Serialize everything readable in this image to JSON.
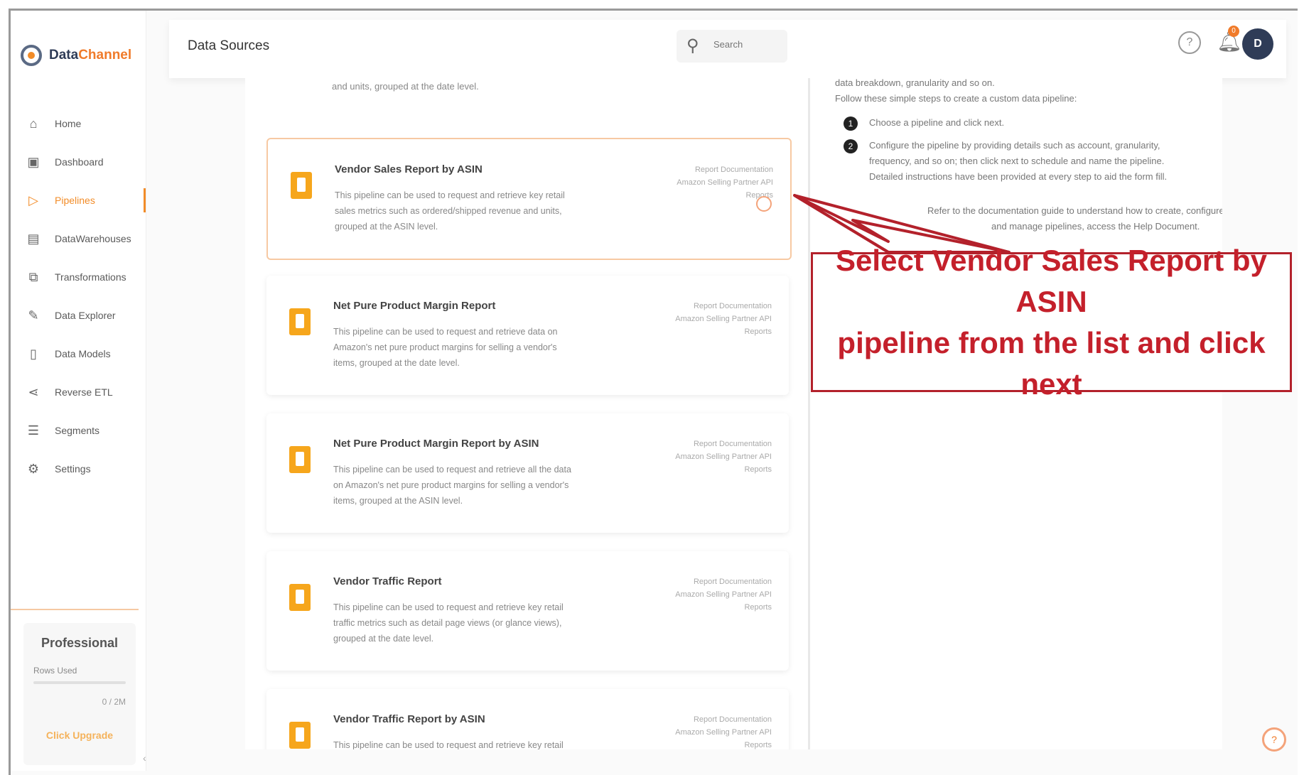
{
  "brand": {
    "name_main": "Data",
    "name_accent": "Channel"
  },
  "sidebar": {
    "items": [
      {
        "label": "Home",
        "icon": "home-icon",
        "glyph": "⌂"
      },
      {
        "label": "Dashboard",
        "icon": "dashboard-icon",
        "glyph": "▣"
      },
      {
        "label": "Pipelines",
        "icon": "pipelines-icon",
        "glyph": "▷"
      },
      {
        "label": "DataWarehouses",
        "icon": "database-icon",
        "glyph": "▤"
      },
      {
        "label": "Transformations",
        "icon": "transform-icon",
        "glyph": "⧉"
      },
      {
        "label": "Data Explorer",
        "icon": "explorer-icon",
        "glyph": "✎"
      },
      {
        "label": "Data Models",
        "icon": "models-icon",
        "glyph": "▯"
      },
      {
        "label": "Reverse ETL",
        "icon": "reverse-etl-icon",
        "glyph": "⋖"
      },
      {
        "label": "Segments",
        "icon": "segments-icon",
        "glyph": "☰"
      },
      {
        "label": "Settings",
        "icon": "settings-icon",
        "glyph": "⚙"
      }
    ],
    "active_index": 2,
    "plan": {
      "title": "Professional",
      "rows_label": "Rows Used",
      "rows_count": "0 / 2M",
      "upgrade_label": "Click Upgrade"
    }
  },
  "header": {
    "title": "Data Sources",
    "search_placeholder": "Search",
    "notification_count": "0",
    "avatar_initial": "D"
  },
  "cards": [
    {
      "title": "Vendor Sales Report by ASIN",
      "desc": "This pipeline can be used to request and retrieve key retail sales metrics such as ordered/shipped revenue and units, grouped at the ASIN level.",
      "meta1": "Report Documentation",
      "meta2": "Amazon Selling Partner API Reports",
      "selected": true
    },
    {
      "title": "Net Pure Product Margin Report",
      "desc": "This pipeline can be used to request and retrieve data on Amazon's net pure product margins for selling a vendor's items, grouped at the date level.",
      "meta1": "Report Documentation",
      "meta2": "Amazon Selling Partner API Reports",
      "selected": false
    },
    {
      "title": "Net Pure Product Margin Report by ASIN",
      "desc": "This pipeline can be used to request and retrieve all the data on Amazon's net pure product margins for selling a vendor's items, grouped at the ASIN level.",
      "meta1": "Report Documentation",
      "meta2": "Amazon Selling Partner API Reports",
      "selected": false
    },
    {
      "title": "Vendor Traffic Report",
      "desc": "This pipeline can be used to request and retrieve key retail traffic metrics such as detail page views (or glance views), grouped at the date level.",
      "meta1": "Report Documentation",
      "meta2": "Amazon Selling Partner API Reports",
      "selected": false
    },
    {
      "title": "Vendor Traffic Report by ASIN",
      "desc": "This pipeline can be used to request and retrieve key retail traffic metrics.",
      "meta1": "Report Documentation",
      "meta2": "Amazon Selling Partner API Reports",
      "selected": false
    }
  ],
  "card_tail_text": "and units, grouped at the date level.",
  "help_panel": {
    "line1": "data breakdown, granularity and so on.",
    "line2": "Follow these simple steps to create a custom data pipeline:",
    "step1_num": "1",
    "step1": "Choose a pipeline and click next.",
    "step2_num": "2",
    "step2": "Configure the pipeline by providing details such as account, granularity, frequency, and so on; then click next to schedule and name the pipeline. Detailed instructions have been provided at every step to aid the form fill.",
    "line3": "Refer to the documentation guide to understand how to create, configure,",
    "line4": "and manage pipelines, access the Help Document."
  },
  "annotation": {
    "line1": "Select Vendor Sales Report by ASIN",
    "line2": "pipeline from the list and click next",
    "color": "#c4202b"
  },
  "fab_glyph": "?",
  "colors": {
    "accent": "#f28c28",
    "brand_dark": "#2f3c57",
    "annotation_red": "#c4202b"
  }
}
